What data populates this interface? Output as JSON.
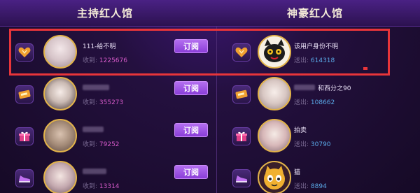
{
  "header": {
    "left_title": "主持红人馆",
    "right_title": "神豪红人馆"
  },
  "left_list": [
    {
      "rank_icon": "heart-icon",
      "name": "111-给不明",
      "stat_label": "收到: ",
      "stat_value": "1225676",
      "button": "订阅"
    },
    {
      "rank_icon": "ticket-icon",
      "name": "",
      "stat_label": "收到: ",
      "stat_value": "355273",
      "button": "订阅"
    },
    {
      "rank_icon": "gift-icon",
      "name": "",
      "stat_label": "收到: ",
      "stat_value": "79252",
      "button": "订阅"
    },
    {
      "rank_icon": "shoe-icon",
      "name": "",
      "stat_label": "收到: ",
      "stat_value": "13314",
      "button": "订阅"
    }
  ],
  "right_list": [
    {
      "rank_icon": "heart-icon",
      "name": "该用户身份不明",
      "stat_label": "送出: ",
      "stat_value": "614318"
    },
    {
      "rank_icon": "ticket-icon",
      "name": "和西分之90",
      "stat_label": "送出: ",
      "stat_value": "108662"
    },
    {
      "rank_icon": "gift-icon",
      "name": "拍卖",
      "stat_label": "送出: ",
      "stat_value": "30790"
    },
    {
      "rank_icon": "shoe-icon",
      "name": "猫",
      "stat_label": "送出: ",
      "stat_value": "8894"
    }
  ],
  "colors": {
    "highlight": "#e8353a",
    "button": "#a25ae8",
    "received_value": "#d65ac9",
    "sent_value": "#5aa9e8"
  }
}
